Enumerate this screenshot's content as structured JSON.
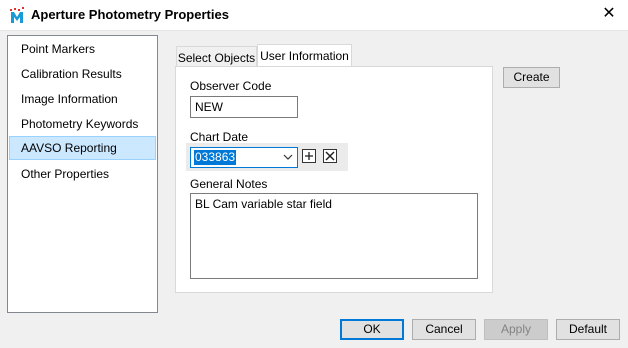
{
  "window": {
    "title": "Aperture Photometry Properties"
  },
  "sidebar": {
    "items": [
      {
        "label": "Point Markers"
      },
      {
        "label": "Calibration Results"
      },
      {
        "label": "Image Information"
      },
      {
        "label": "Photometry Keywords"
      },
      {
        "label": "AAVSO Reporting",
        "selected": true
      },
      {
        "label": "Other Properties"
      }
    ]
  },
  "tabs": [
    {
      "label": "Select Objects"
    },
    {
      "label": "User Information",
      "active": true
    }
  ],
  "form": {
    "observer_code_label": "Observer Code",
    "observer_code_value": "NEW",
    "chart_date_label": "Chart Date",
    "chart_date_value": "033863",
    "general_notes_label": "General Notes",
    "general_notes_value": "BL Cam variable star field"
  },
  "buttons": {
    "create": "Create",
    "ok": "OK",
    "cancel": "Cancel",
    "apply": "Apply",
    "default": "Default"
  },
  "colors": {
    "selection": "#cce8ff",
    "accent": "#0078d7"
  }
}
